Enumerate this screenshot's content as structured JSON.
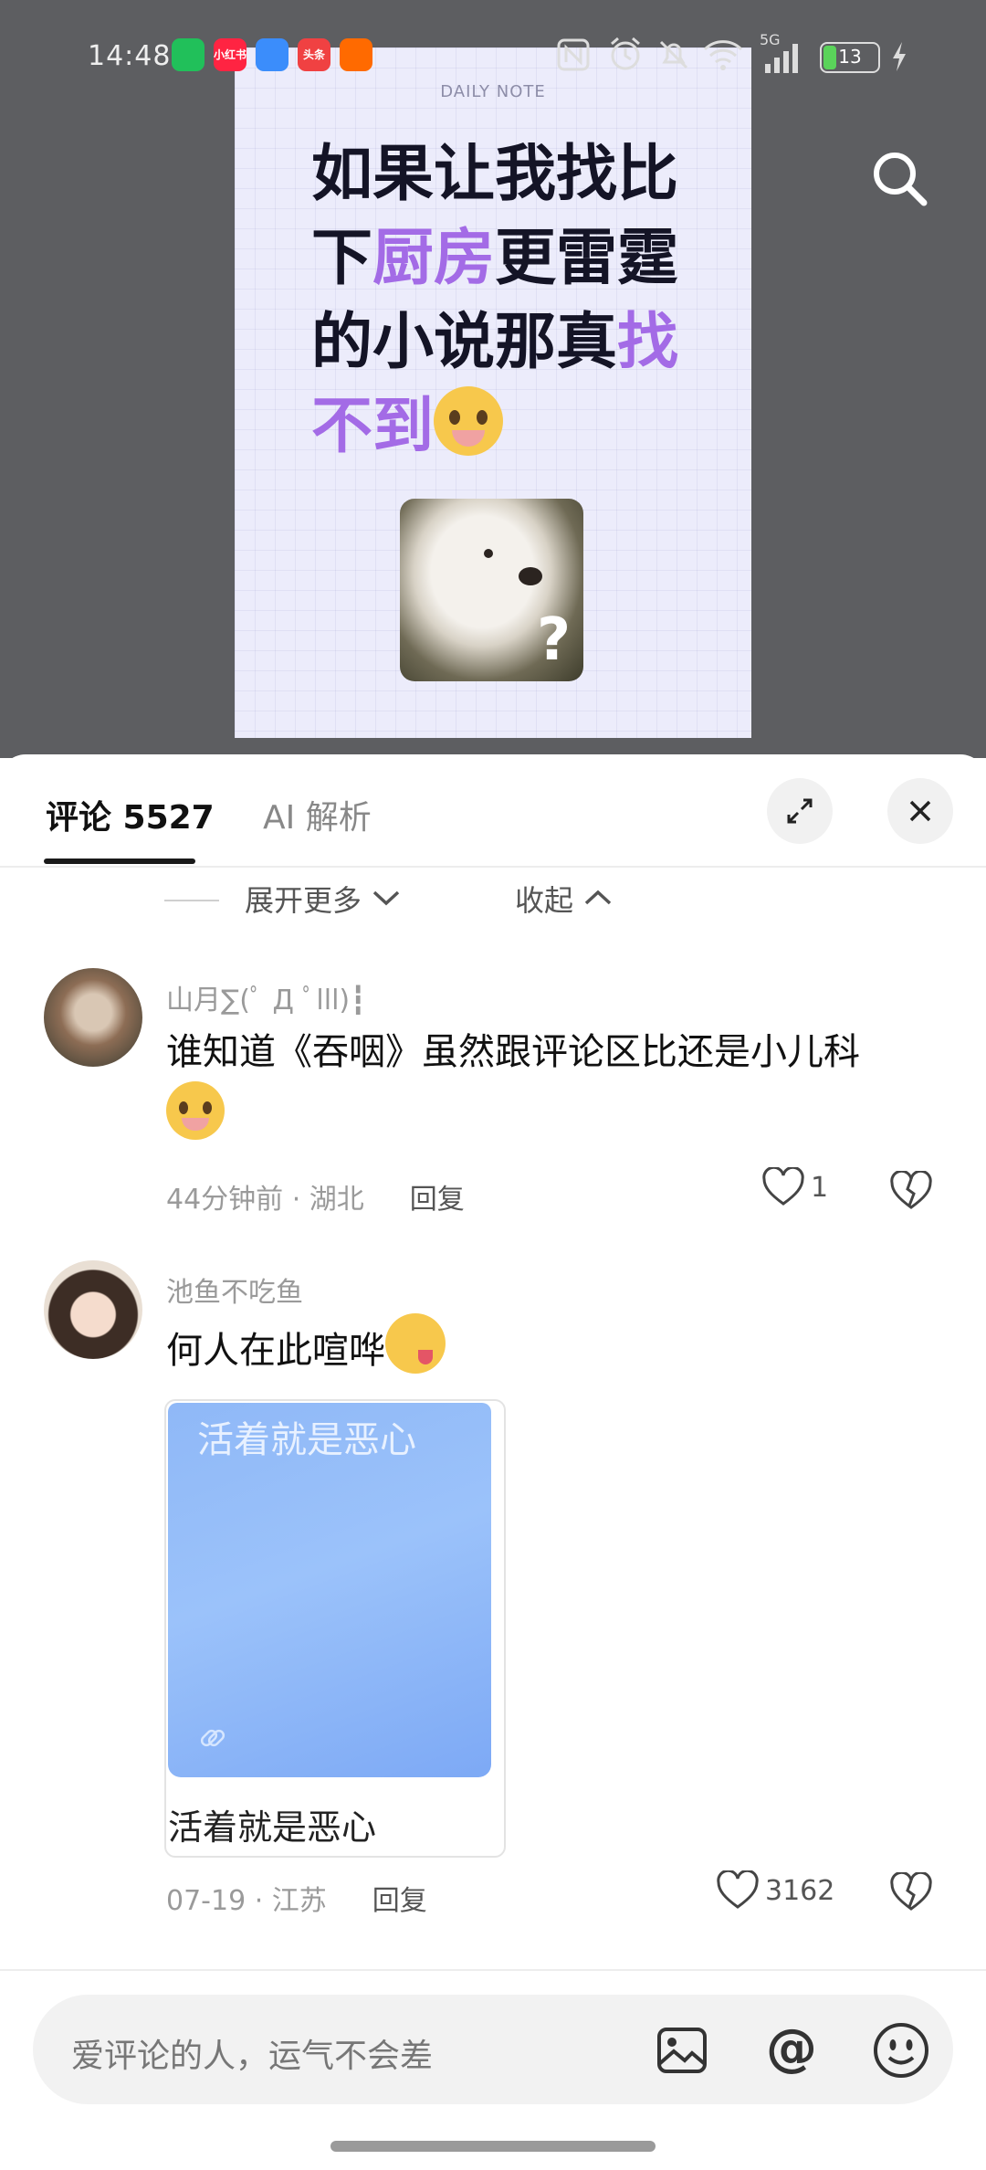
{
  "status_bar": {
    "time": "14:48",
    "apps": [
      {
        "name": "wechat-icon",
        "label": "",
        "color": "#21c05a"
      },
      {
        "name": "xiaohongshu-icon",
        "label": "小红书",
        "color": "#ff2442"
      },
      {
        "name": "baidu-netdisk-icon",
        "label": "",
        "color": "#3b8dfb"
      },
      {
        "name": "toutiao-icon",
        "label": "头条",
        "color": "#f04142"
      },
      {
        "name": "taobao-icon",
        "label": "",
        "color": "#ff6a00"
      }
    ],
    "network": "5G",
    "battery": "13"
  },
  "note": {
    "label": "DAILY NOTE",
    "line1": "如果让我找比",
    "line2_a": "下",
    "line2_b": "厨房",
    "line2_c": "更雷霆",
    "line3_a": "的小说那真",
    "line3_b": "找",
    "line4": "不到"
  },
  "tabs": {
    "comments": "评论 5527",
    "ai": "AI 解析"
  },
  "expand_row": {
    "more": "展开更多",
    "collapse": "收起"
  },
  "comments": [
    {
      "nickname": "山月∑(ﾟ Д ﾟlll)┇",
      "text": "谁知道《吞咽》虽然跟评论区比还是小儿科",
      "time_location": "44分钟前 · 湖北",
      "reply": "回复",
      "likes": "1"
    },
    {
      "nickname": "池鱼不吃鱼",
      "text": "何人在此喧哗",
      "sticker_text": "活着就是恶心",
      "sticker_caption": "活着就是恶心",
      "time_location": "07-19 · 江苏",
      "reply": "回复",
      "likes": "3162"
    }
  ],
  "input": {
    "placeholder": "爱评论的人，运气不会差"
  },
  "colors": {
    "accent_purple": "#a36be6",
    "sheet_bg": "#ffffff",
    "video_bg": "#5d5e61"
  }
}
